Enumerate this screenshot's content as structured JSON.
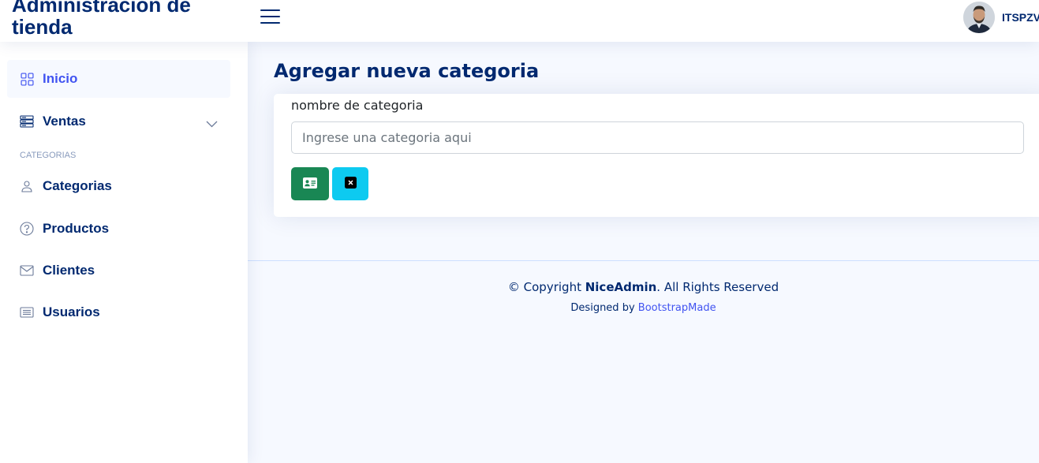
{
  "header": {
    "logo_line1": "Administracion de",
    "logo_line2": "tienda",
    "username": "ITSPZV",
    "menu_icon": "hamburger-menu-icon"
  },
  "sidebar": {
    "items": [
      {
        "label": "Inicio",
        "icon": "grid-icon",
        "active": true
      },
      {
        "label": "Ventas",
        "icon": "server-list-icon",
        "expandable": true
      },
      {
        "label": "Categorias",
        "icon": "person-icon"
      },
      {
        "label": "Productos",
        "icon": "question-circle-icon"
      },
      {
        "label": "Clientes",
        "icon": "envelope-icon"
      },
      {
        "label": "Usuarios",
        "icon": "list-card-icon"
      }
    ],
    "heading": "CATEGORIAS"
  },
  "main": {
    "title": "Agregar nueva categoria",
    "form": {
      "label": "nombre de categoria",
      "placeholder": "Ingrese una categoria aqui",
      "value": ""
    },
    "buttons": {
      "save_icon": "id-card-icon",
      "cancel_icon": "x-square-icon"
    }
  },
  "footer": {
    "copyright_prefix": "© Copyright ",
    "copyright_brand": "NiceAdmin",
    "copyright_suffix": ". All Rights Reserved",
    "designed_by": "Designed by ",
    "designer": "BootstrapMade"
  },
  "colors": {
    "primary": "#012970",
    "accent": "#4154f1",
    "success": "#198754",
    "info": "#0dcaf0",
    "background": "#f6f9ff"
  }
}
